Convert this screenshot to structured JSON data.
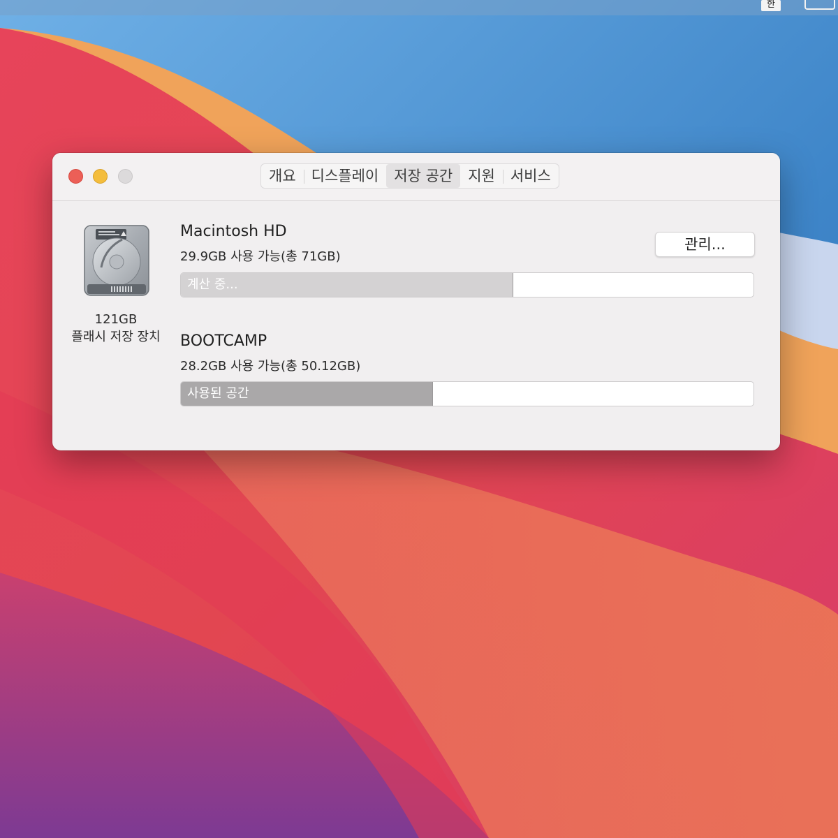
{
  "menubar": {
    "ime": "한"
  },
  "window": {
    "tabs": [
      {
        "label": "개요",
        "selected": false
      },
      {
        "label": "디스플레이",
        "selected": false
      },
      {
        "label": "저장 공간",
        "selected": true
      },
      {
        "label": "지원",
        "selected": false
      },
      {
        "label": "서비스",
        "selected": false
      }
    ],
    "device": {
      "icon": "hard-drive-icon",
      "capacity": "121GB",
      "type": "플래시 저장 장치"
    },
    "volumes": [
      {
        "name": "Macintosh HD",
        "available": "29.9GB 사용 가능(총 71GB)",
        "bar_label": "계산 중...",
        "used_fraction": 0.58,
        "fill_color": "#d4d2d3",
        "manage_label": "관리..."
      },
      {
        "name": "BOOTCAMP",
        "available": "28.2GB 사용 가능(총 50.12GB)",
        "bar_label": "사용된 공간",
        "used_fraction": 0.44,
        "fill_color": "#aaa8a9"
      }
    ]
  },
  "colors": {
    "close": "#ec5f57",
    "minimize": "#f4bd3c",
    "zoom": "#dcdadb"
  }
}
